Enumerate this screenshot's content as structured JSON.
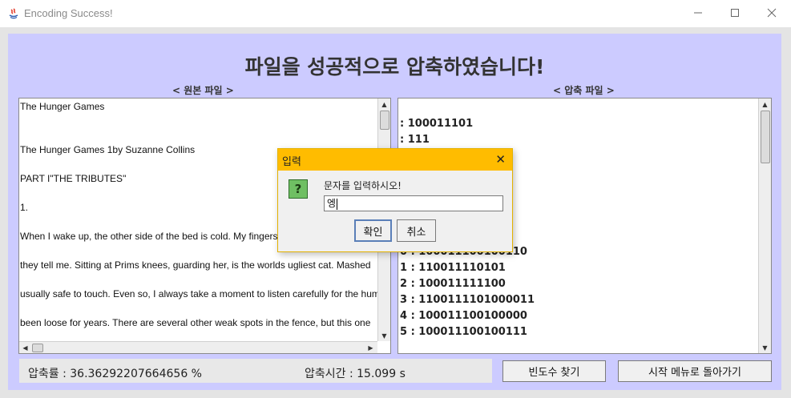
{
  "window": {
    "title": "Encoding Success!",
    "minimize_icon": "minimize-icon",
    "maximize_icon": "maximize-icon",
    "close_icon": "close-icon"
  },
  "heading": "파일을 성공적으로 압축하였습니다!",
  "original_panel": {
    "label": "< 원본 파일 >",
    "lines": [
      "The Hunger Games",
      "",
      "",
      "The Hunger Games 1by Suzanne Collins",
      "",
      "PART I\"THE TRIBUTES\"",
      "",
      "1.",
      "",
      "When I wake up, the other side of the bed is cold. My fingers",
      "",
      "they tell me. Sitting at Prims knees, guarding her, is the worlds ugliest cat. Mashed",
      "",
      "usually safe to touch. Even so, I always take a moment to listen carefully for the hum",
      "",
      "been loose for years. There are several other weak spots in the fence, but this one"
    ]
  },
  "compressed_panel": {
    "label": "< 압축 파일 >",
    "lines": [
      ": 100011101",
      " : 111",
      "",
      "",
      "",
      "",
      "",
      "",
      "0 : 100011100100110",
      "1 : 110011110101",
      "2 : 100011111100",
      "3 : 1100111101000011",
      "4 : 100011100100000",
      "5 : 100011100100111"
    ]
  },
  "status": {
    "ratio": "압축률 : 36.36292207664656 %",
    "time": "압축시간 : 15.099 s"
  },
  "buttons": {
    "frequency": "빈도수 찾기",
    "back_to_menu": "시작 메뉴로 돌아가기"
  },
  "dialog": {
    "title": "입력",
    "prompt": "문자를 입력하시오!",
    "input_value": "엥",
    "ok": "확인",
    "cancel": "취소"
  }
}
